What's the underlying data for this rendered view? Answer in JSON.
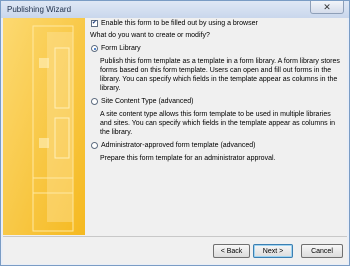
{
  "window": {
    "title": "Publishing Wizard",
    "close_glyph": "✕"
  },
  "form": {
    "enable_browser_checkbox": {
      "label": "Enable this form to be filled out by using a browser",
      "checked": true
    },
    "question": "What do you want to create or modify?"
  },
  "options": [
    {
      "label": "Form Library",
      "selected": true,
      "description": "Publish this form template as a template in a form library. A form library stores forms based on this form template. Users can open and fill out forms in the library. You can specify which fields in the template appear as columns in the library."
    },
    {
      "label": "Site Content Type (advanced)",
      "selected": false,
      "description": "A site content type allows this form template to be used in multiple libraries and sites. You can specify which fields in the template appear as columns in the library."
    },
    {
      "label": "Administrator-approved form template (advanced)",
      "selected": false,
      "description": "Prepare this form template for an administrator approval."
    }
  ],
  "buttons": {
    "back": "< Back",
    "next": "Next >",
    "cancel": "Cancel"
  },
  "colors": {
    "banner": "#f6c02c",
    "selection_accent": "#1b5fbf"
  }
}
